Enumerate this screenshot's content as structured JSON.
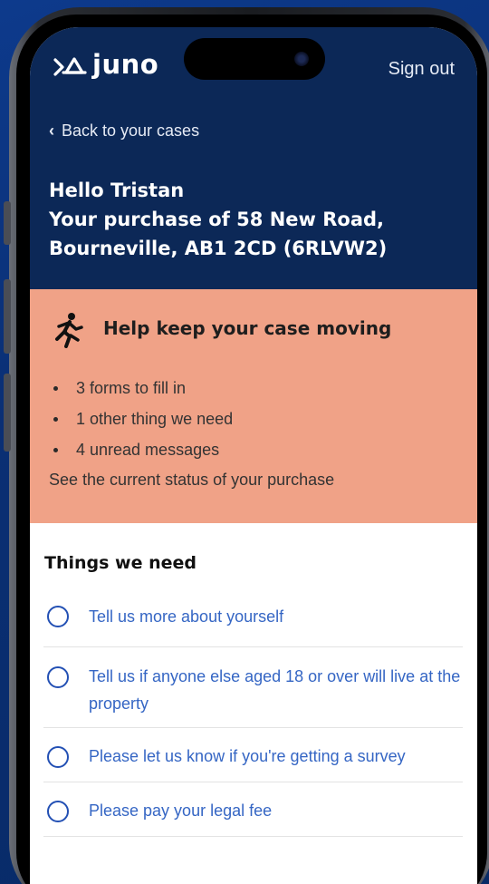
{
  "header": {
    "logo_text": "juno",
    "sign_out_label": "Sign out",
    "back_label": "Back to your cases",
    "greeting": "Hello Tristan",
    "purchase_title": "Your purchase of 58 New Road, Bourneville, AB1 2CD (6RLVW2)"
  },
  "help_card": {
    "title": "Help keep your case moving",
    "items": [
      "3 forms to fill in",
      "1 other thing we need",
      "4 unread messages"
    ],
    "status_link": "See the current status of your purchase",
    "background_color": "#f0a287"
  },
  "needs": {
    "title": "Things we need",
    "tasks": [
      "Tell us more about yourself",
      "Tell us if anyone else aged 18 or over will live at the property",
      "Please let us know if you're getting a survey",
      "Please pay your legal fee"
    ]
  },
  "colors": {
    "brand_navy": "#0c2857",
    "task_link": "#3566c4",
    "radio_border": "#2350b4"
  },
  "icons": {
    "logo": "juno-logo-icon",
    "back": "chevron-left-icon",
    "help": "running-person-icon",
    "task": "radio-unchecked-icon"
  }
}
